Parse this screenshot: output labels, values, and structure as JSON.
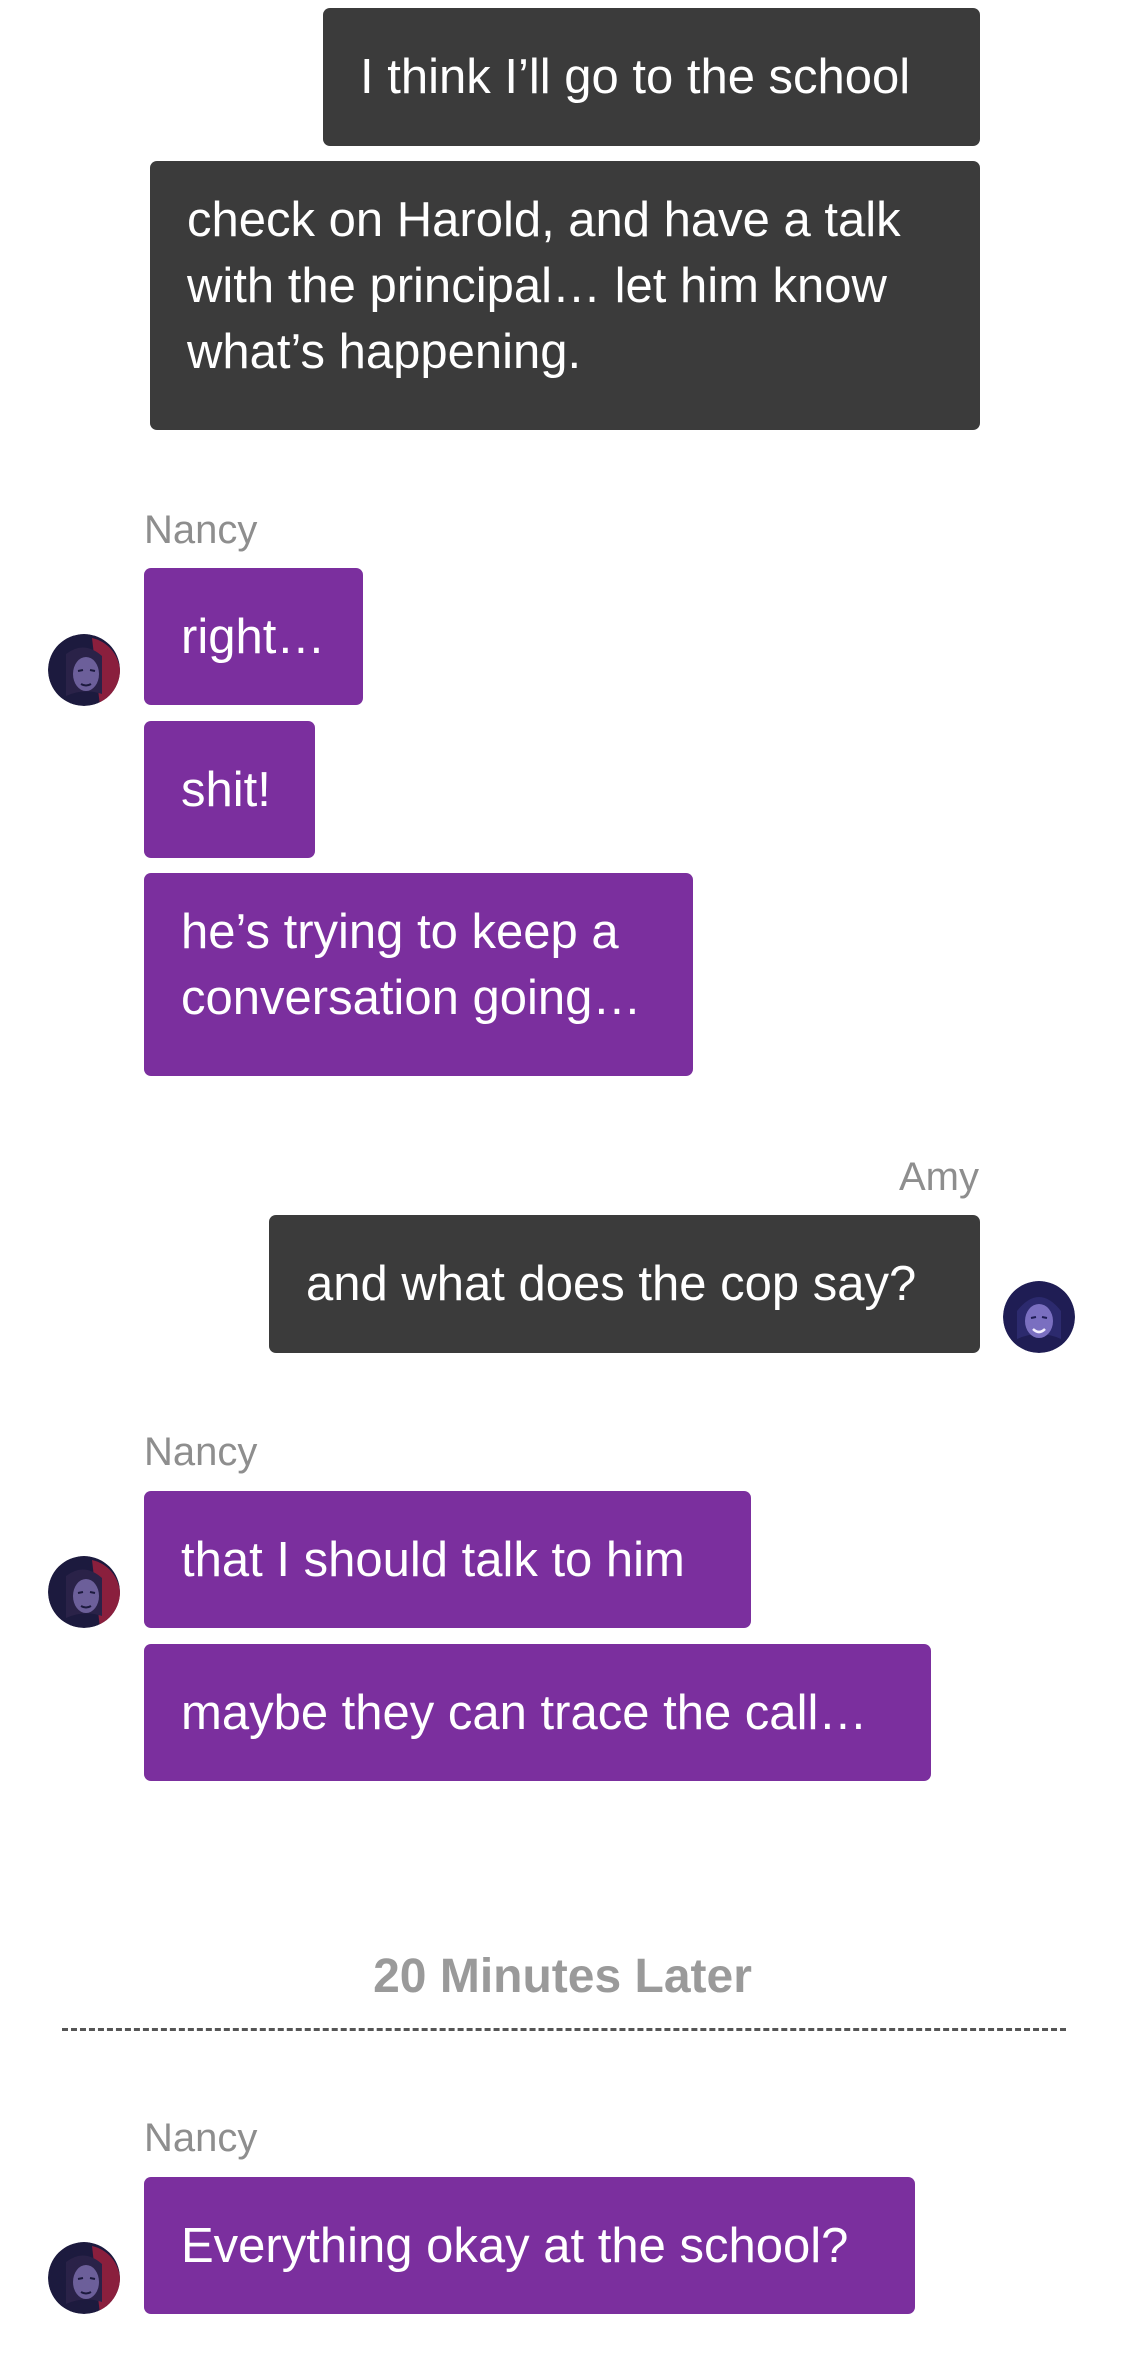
{
  "messages": [
    {
      "text": "I think I’ll go to the school"
    },
    {
      "text": "check on Harold, and have a talk\nwith the principal… let him know\nwhat’s happening."
    },
    {
      "sender": "Nancy"
    },
    {
      "text": "right…"
    },
    {
      "text": "shit!"
    },
    {
      "text": "he’s trying to keep a\nconversation going…"
    },
    {
      "sender": "Amy"
    },
    {
      "text": "and what does the cop say?"
    },
    {
      "sender": "Nancy"
    },
    {
      "text": "that I should talk to him"
    },
    {
      "text": "maybe they can trace the call…"
    },
    {
      "sender": "Nancy"
    },
    {
      "text": "Everything okay at the school?"
    }
  ],
  "separator": {
    "label": "20 Minutes Later"
  },
  "avatars": {
    "nancy_icon": "nancy-avatar-icon",
    "amy_icon": "amy-avatar-icon"
  },
  "colors": {
    "outgoing_bubble": "#3b3b3b",
    "incoming_bubble": "#7b2f9e",
    "sender_label": "#8e8e8e",
    "separator_label": "#9a9a9a",
    "background": "#ffffff"
  }
}
